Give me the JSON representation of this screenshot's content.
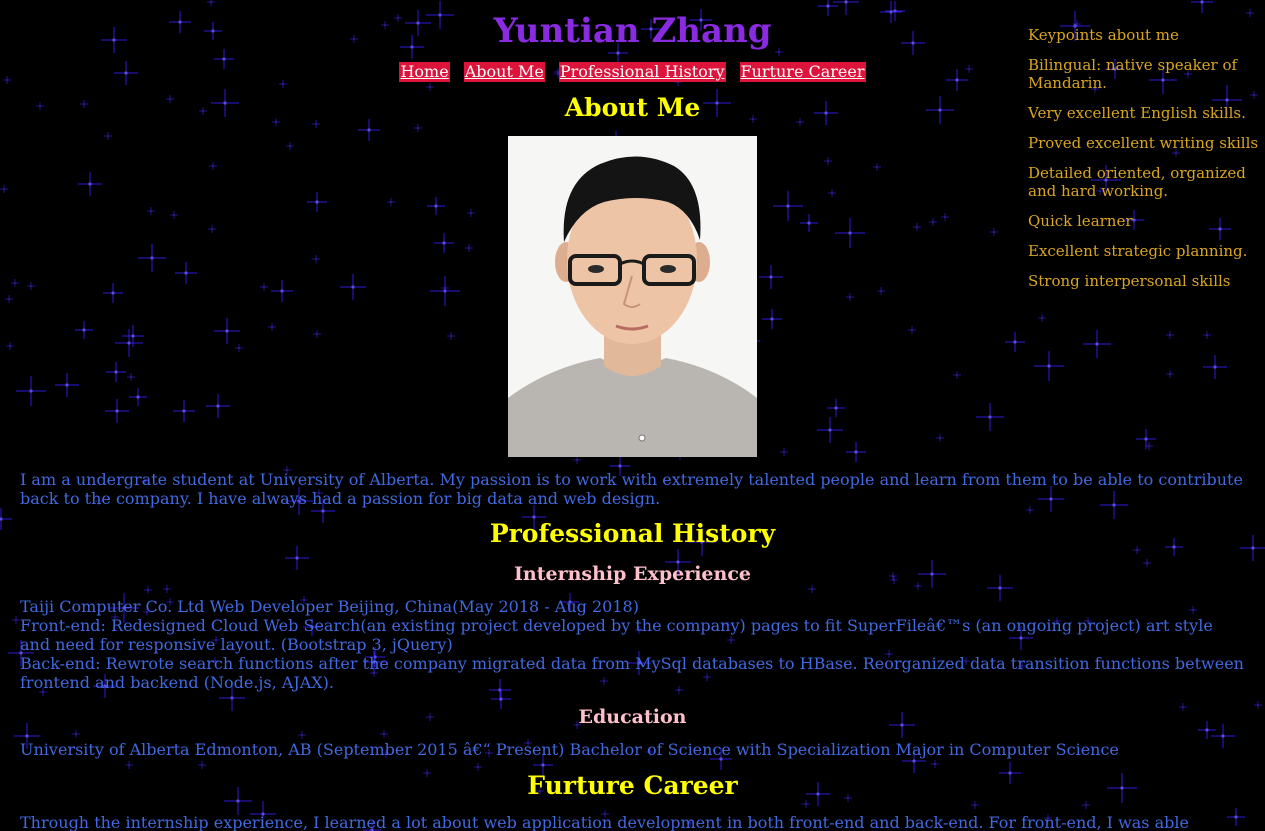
{
  "header": {
    "title": "Yuntian Zhang"
  },
  "nav": {
    "items": [
      {
        "label": "Home"
      },
      {
        "label": "About Me"
      },
      {
        "label": "Professional History"
      },
      {
        "label": "Furture Career"
      }
    ]
  },
  "about": {
    "heading": "About Me",
    "photo_alt": "portrait",
    "text": "I am a undergrate student at University of Alberta. My passion is to work with extremely talented people and learn from them to be able to contribute back to the company. I have always had a passion for big data and web design."
  },
  "history": {
    "heading": "Professional History",
    "internship_heading": "Internship Experience",
    "internship_lines": [
      "Taiji Computer Co. Ltd Web Developer Beijing, China(May 2018 - Aug 2018)",
      "Front-end: Redesigned Cloud Web Search(an existing project developed by the company) pages to fit SuperFileâ€™s (an ongoing project) art style and need for responsive layout. (Bootstrap 3, jQuery)",
      "Back-end: Rewrote search functions after the company migrated data from MySql databases to HBase. Reorganized data transition functions between frontend and backend (Node.js, AJAX)."
    ],
    "education_heading": "Education",
    "education_text": "University of Alberta Edmonton, AB (September 2015 â€“ Present) Bachelor of Science with Specialization Major in Computer Science"
  },
  "career": {
    "heading": "Furture Career",
    "text": "Through the internship experience, I learned a lot about web application development in both front-end and back-end. For front-end, I was able"
  },
  "keypoints": {
    "heading": "Keypoints about me",
    "items": [
      "Bilingual: native speaker of Mandarin.",
      "Very excellent English skills.",
      "Proved excellent writing skills",
      "Detailed oriented, organized and hard working.",
      "Quick learner",
      "Excellent strategic planning.",
      "Strong interpersonal skills"
    ]
  },
  "colors": {
    "background": "#000000",
    "title": "#8a2be2",
    "heading": "#ffff00",
    "subheading": "#ffc0cb",
    "body_text": "#4169e1",
    "nav_bg": "#dc143c",
    "keypoints_text": "#daa520",
    "stars": "#3a1fff"
  }
}
